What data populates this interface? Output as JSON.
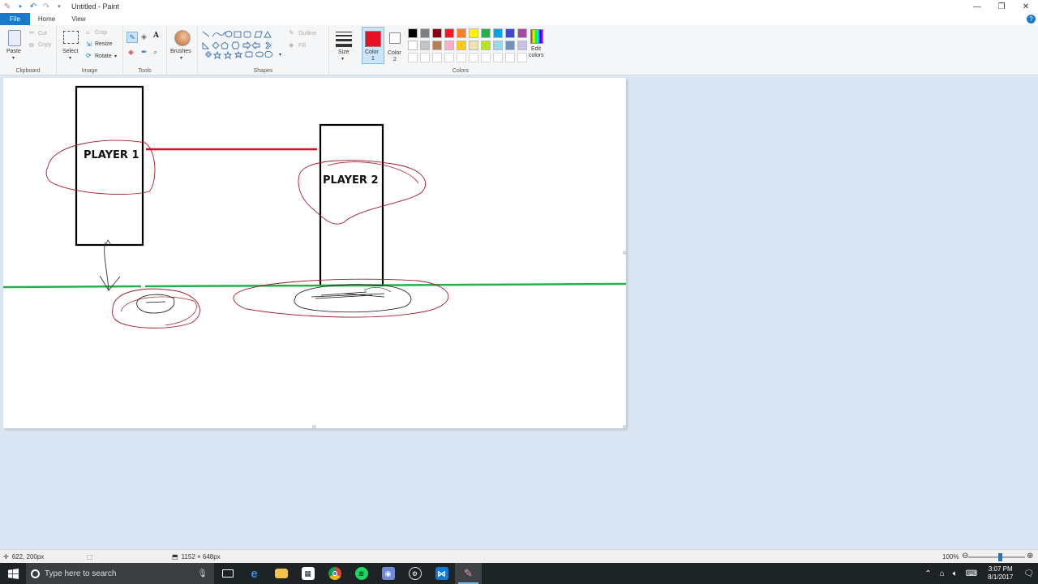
{
  "window": {
    "title": "Untitled - Paint",
    "controls": {
      "minimize": "—",
      "restore": "❐",
      "close": "✕"
    }
  },
  "tabs": {
    "file": "File",
    "home": "Home",
    "view": "View"
  },
  "ribbon": {
    "clipboard": {
      "paste": "Paste",
      "cut": "Cut",
      "copy": "Copy",
      "label": "Clipboard"
    },
    "image": {
      "select": "Select",
      "crop": "Crop",
      "resize": "Resize",
      "rotate": "Rotate",
      "label": "Image"
    },
    "tools": {
      "label": "Tools"
    },
    "brushes": {
      "label": "Brushes"
    },
    "shapes": {
      "outline": "Outline",
      "fill": "Fill",
      "label": "Shapes"
    },
    "size": {
      "label": "Size"
    },
    "color1": {
      "label": "Color",
      "num": "1",
      "value": "#e81123"
    },
    "color2": {
      "label": "Color",
      "num": "2",
      "value": "#ffffff"
    },
    "colors_label": "Colors",
    "edit_colors": {
      "line1": "Edit",
      "line2": "colors"
    },
    "palette_row1": [
      "#000000",
      "#7f7f7f",
      "#880015",
      "#ed1c24",
      "#ff7f27",
      "#fff200",
      "#22b14c",
      "#00a2e8",
      "#3f48cc",
      "#a349a4"
    ],
    "palette_row2": [
      "#ffffff",
      "#c3c3c3",
      "#b97a57",
      "#ffaec9",
      "#ffc90e",
      "#efe4b0",
      "#b5e61d",
      "#99d9ea",
      "#7092be",
      "#c8bfe7"
    ],
    "palette_row3": [
      "#ffffff",
      "#ffffff",
      "#ffffff",
      "#ffffff",
      "#ffffff",
      "#ffffff",
      "#ffffff",
      "#ffffff",
      "#ffffff",
      "#ffffff"
    ]
  },
  "canvas": {
    "player1": "PLAYER 1",
    "player2": "PLAYER 2",
    "colors": {
      "outline": "#000000",
      "ground": "#22b14c",
      "red_line": "#d01427",
      "circles": "#a31b2d"
    }
  },
  "status": {
    "cursor_pos": "622, 200px",
    "image_size": "1152 × 648px",
    "zoom": "100%"
  },
  "taskbar": {
    "search_placeholder": "Type here to search",
    "time": "3:07 PM",
    "date": "8/1/2017"
  }
}
